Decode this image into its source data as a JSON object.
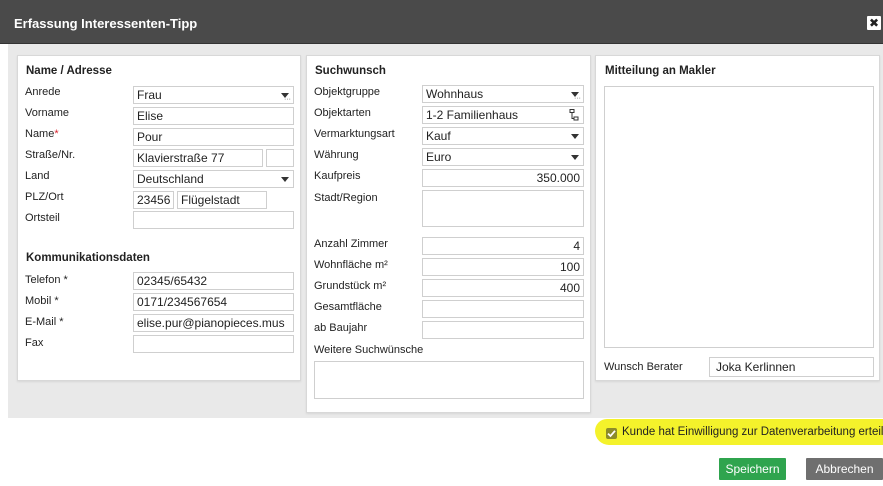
{
  "dialog": {
    "title": "Erfassung Interessenten-Tipp",
    "close_glyph": "✖"
  },
  "address": {
    "heading": "Name / Adresse",
    "anrede_label": "Anrede",
    "anrede_value": "Frau",
    "vorname_label": "Vorname",
    "vorname_value": "Elise",
    "name_label": "Name",
    "name_required": "*",
    "name_value": "Pour",
    "strasse_label": "Straße/Nr.",
    "strasse_value": "Klavierstraße 77",
    "hausnr_value": "",
    "land_label": "Land",
    "land_value": "Deutschland",
    "plzort_label": "PLZ/Ort",
    "plz_value": "23456",
    "ort_value": "Flügelstadt",
    "ortsteil_label": "Ortsteil",
    "ortsteil_value": ""
  },
  "communication": {
    "heading": "Kommunikationsdaten",
    "telefon_label": "Telefon *",
    "telefon_value": "02345/65432",
    "mobil_label": "Mobil *",
    "mobil_value": "0171/234567654",
    "email_label": "E-Mail *",
    "email_value": "elise.pur@pianopieces.mus",
    "fax_label": "Fax",
    "fax_value": ""
  },
  "search": {
    "heading": "Suchwunsch",
    "objektgruppe_label": "Objektgruppe",
    "objektgruppe_value": "Wohnhaus",
    "objektarten_label": "Objektarten",
    "objektarten_value": "1-2 Familienhaus",
    "vermarktungsart_label": "Vermarktungsart",
    "vermarktungsart_value": "Kauf",
    "waehrung_label": "Währung",
    "waehrung_value": "Euro",
    "kaufpreis_label": "Kaufpreis",
    "kaufpreis_value": "350.000",
    "stadt_label": "Stadt/Region",
    "stadt_value": "",
    "zimmer_label": "Anzahl Zimmer",
    "zimmer_value": "4",
    "wohnflaeche_label": "Wohnfläche m²",
    "wohnflaeche_value": "100",
    "grundstueck_label": "Grundstück m²",
    "grundstueck_value": "400",
    "gesamtflaeche_label": "Gesamtfläche",
    "gesamtflaeche_value": "",
    "baujahr_label": "ab Baujahr",
    "baujahr_value": "",
    "weitere_label": "Weitere Suchwünsche",
    "weitere_value": ""
  },
  "message": {
    "heading": "Mitteilung an Makler",
    "text": "",
    "berater_label": "Wunsch Berater",
    "berater_value": "Joka Kerlinnen"
  },
  "consent": {
    "checked": true,
    "label": "Kunde hat Einwilligung zur Datenverarbeitung erteilt"
  },
  "actions": {
    "save_label": "Speichern",
    "cancel_label": "Abbrechen"
  },
  "colors": {
    "titlebar": "#4a4a4a",
    "save_button": "#2fa44e",
    "cancel_button": "#6f6f6f",
    "highlight": "#f4f22b",
    "required_marker": "#d9232d"
  }
}
